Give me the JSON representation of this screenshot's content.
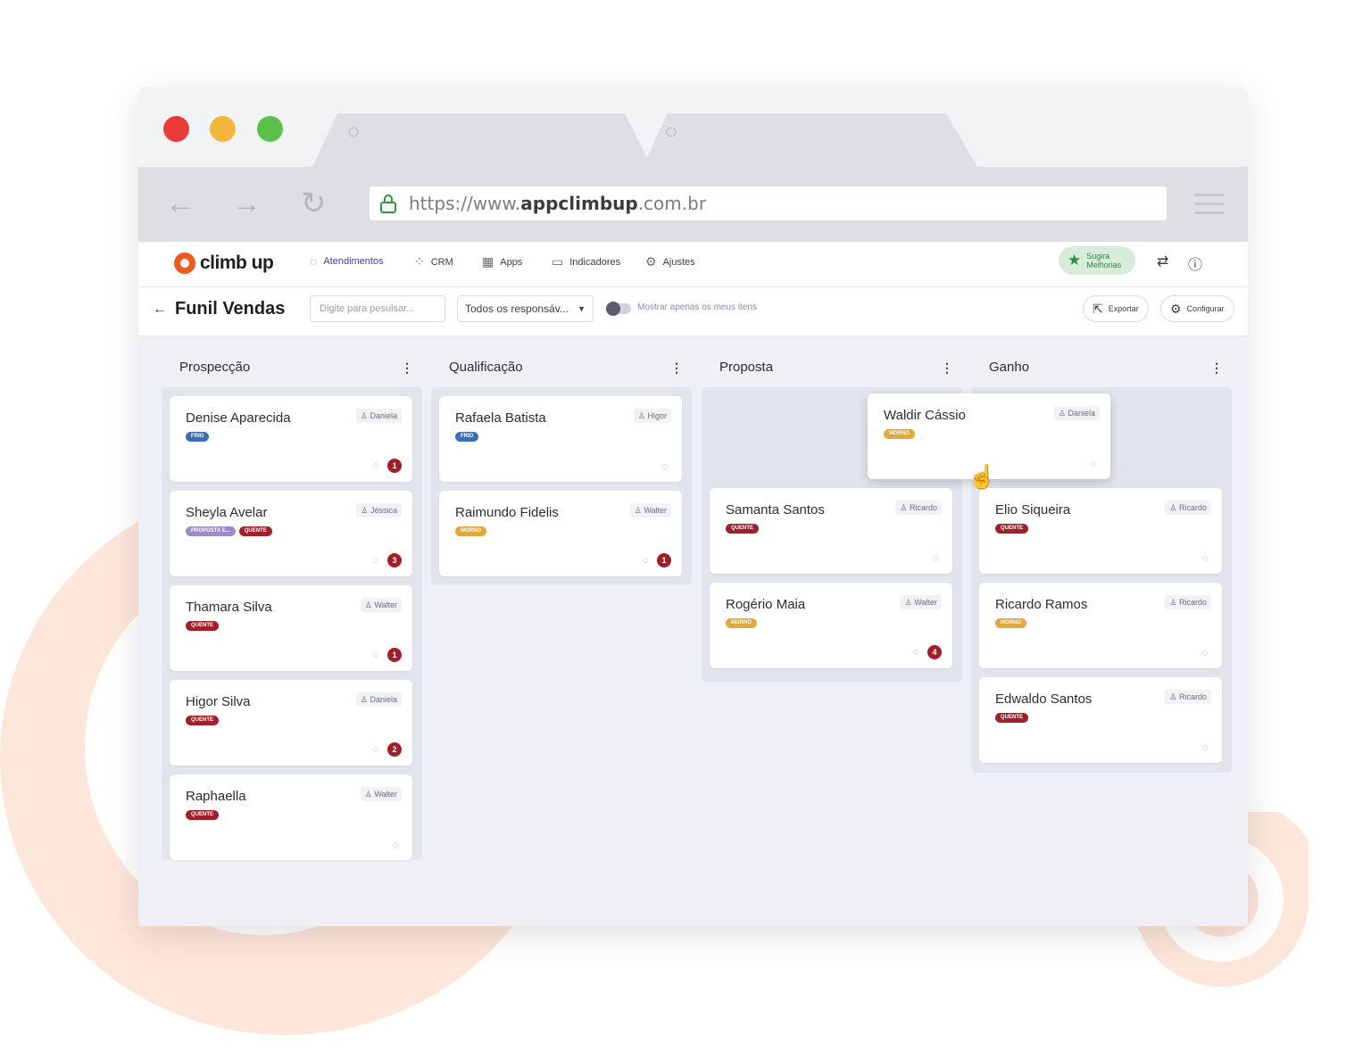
{
  "browser": {
    "url_prefix": "https://www.",
    "url_domain": "appclimbup",
    "url_suffix": ".com.br",
    "back_icon": "←",
    "forward_icon": "→",
    "reload_icon": "↻"
  },
  "app": {
    "logo": "climb up",
    "nav": [
      {
        "label": "Atendimentos",
        "icon": "chat-icon"
      },
      {
        "label": "CRM",
        "icon": "crm-icon"
      },
      {
        "label": "Apps",
        "icon": "apps-icon"
      },
      {
        "label": "Indicadores",
        "icon": "chart-icon"
      },
      {
        "label": "Ajustes",
        "icon": "gear-icon"
      }
    ],
    "suggest": "Sugira Melhorias",
    "brand_color": "#f05a1e"
  },
  "toolbar": {
    "title": "Funil Vendas",
    "search_placeholder": "Digite para pesuisar...",
    "responsible": "Todos os responsáv...",
    "toggle_label": "Mostrar apenas os meus itens",
    "export": "Exportar",
    "configure": "Configurar"
  },
  "columns": [
    {
      "title": "Prospecção",
      "cards": [
        {
          "name": "Denise Aparecida",
          "owner": "Daniela",
          "tags": [
            "FRIO"
          ],
          "count": "1"
        },
        {
          "name": "Sheyla Avelar",
          "owner": "Jéssica",
          "tags": [
            "PROPOSTA E...",
            "QUENTE"
          ],
          "count": "3"
        },
        {
          "name": "Thamara Silva",
          "owner": "Walter",
          "tags": [
            "QUENTE"
          ],
          "count": "1"
        },
        {
          "name": "Higor Silva",
          "owner": "Daniela",
          "tags": [
            "QUENTE"
          ],
          "count": "2"
        },
        {
          "name": "Raphaella",
          "owner": "Walter",
          "tags": [
            "QUENTE"
          ],
          "count": ""
        }
      ]
    },
    {
      "title": "Qualificação",
      "cards": [
        {
          "name": "Rafaela Batista",
          "owner": "Higor",
          "tags": [
            "FRIO"
          ],
          "count": ""
        },
        {
          "name": "Raimundo Fidelis",
          "owner": "Walter",
          "tags": [
            "MORNO"
          ],
          "count": "1"
        }
      ]
    },
    {
      "title": "Proposta",
      "cards": [
        {
          "name": "Samanta Santos",
          "owner": "Ricardo",
          "tags": [
            "QUENTE"
          ],
          "count": ""
        },
        {
          "name": "Rogério Maia",
          "owner": "Walter",
          "tags": [
            "MORNO"
          ],
          "count": "4"
        }
      ]
    },
    {
      "title": "Ganho",
      "cards": [
        {
          "name": "Elio Siqueira",
          "owner": "Ricardo",
          "tags": [
            "QUENTE"
          ],
          "count": ""
        },
        {
          "name": "Ricardo Ramos",
          "owner": "Ricardo",
          "tags": [
            "MORNO"
          ],
          "count": ""
        },
        {
          "name": "Edwaldo Santos",
          "owner": "Ricardo",
          "tags": [
            "QUENTE"
          ],
          "count": ""
        }
      ]
    }
  ],
  "dragged_card": {
    "name": "Waldir Cássio",
    "owner": "Daniela",
    "tags": [
      "MORNO"
    ],
    "count": ""
  },
  "tag_colors": {
    "FRIO": "#3c6fb5",
    "QUENTE": "#a11f2b",
    "MORNO": "#e3a83a",
    "PROPOSTA E...": "#9d8cc8"
  }
}
